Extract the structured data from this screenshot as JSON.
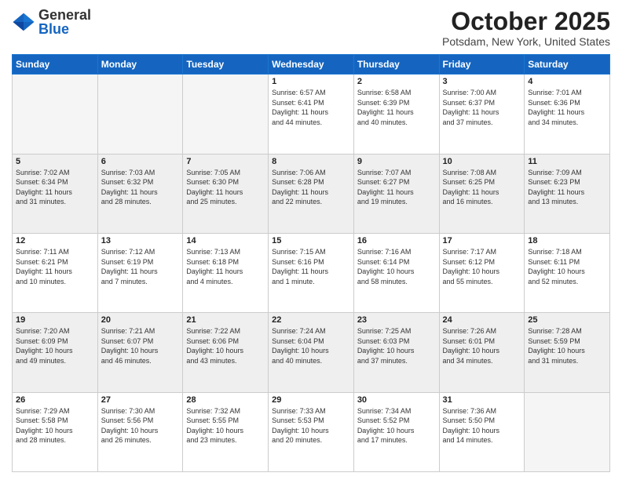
{
  "header": {
    "logo_general": "General",
    "logo_blue": "Blue",
    "month_title": "October 2025",
    "location": "Potsdam, New York, United States"
  },
  "days_of_week": [
    "Sunday",
    "Monday",
    "Tuesday",
    "Wednesday",
    "Thursday",
    "Friday",
    "Saturday"
  ],
  "weeks": [
    [
      {
        "day": "",
        "info": ""
      },
      {
        "day": "",
        "info": ""
      },
      {
        "day": "",
        "info": ""
      },
      {
        "day": "1",
        "info": "Sunrise: 6:57 AM\nSunset: 6:41 PM\nDaylight: 11 hours\nand 44 minutes."
      },
      {
        "day": "2",
        "info": "Sunrise: 6:58 AM\nSunset: 6:39 PM\nDaylight: 11 hours\nand 40 minutes."
      },
      {
        "day": "3",
        "info": "Sunrise: 7:00 AM\nSunset: 6:37 PM\nDaylight: 11 hours\nand 37 minutes."
      },
      {
        "day": "4",
        "info": "Sunrise: 7:01 AM\nSunset: 6:36 PM\nDaylight: 11 hours\nand 34 minutes."
      }
    ],
    [
      {
        "day": "5",
        "info": "Sunrise: 7:02 AM\nSunset: 6:34 PM\nDaylight: 11 hours\nand 31 minutes."
      },
      {
        "day": "6",
        "info": "Sunrise: 7:03 AM\nSunset: 6:32 PM\nDaylight: 11 hours\nand 28 minutes."
      },
      {
        "day": "7",
        "info": "Sunrise: 7:05 AM\nSunset: 6:30 PM\nDaylight: 11 hours\nand 25 minutes."
      },
      {
        "day": "8",
        "info": "Sunrise: 7:06 AM\nSunset: 6:28 PM\nDaylight: 11 hours\nand 22 minutes."
      },
      {
        "day": "9",
        "info": "Sunrise: 7:07 AM\nSunset: 6:27 PM\nDaylight: 11 hours\nand 19 minutes."
      },
      {
        "day": "10",
        "info": "Sunrise: 7:08 AM\nSunset: 6:25 PM\nDaylight: 11 hours\nand 16 minutes."
      },
      {
        "day": "11",
        "info": "Sunrise: 7:09 AM\nSunset: 6:23 PM\nDaylight: 11 hours\nand 13 minutes."
      }
    ],
    [
      {
        "day": "12",
        "info": "Sunrise: 7:11 AM\nSunset: 6:21 PM\nDaylight: 11 hours\nand 10 minutes."
      },
      {
        "day": "13",
        "info": "Sunrise: 7:12 AM\nSunset: 6:19 PM\nDaylight: 11 hours\nand 7 minutes."
      },
      {
        "day": "14",
        "info": "Sunrise: 7:13 AM\nSunset: 6:18 PM\nDaylight: 11 hours\nand 4 minutes."
      },
      {
        "day": "15",
        "info": "Sunrise: 7:15 AM\nSunset: 6:16 PM\nDaylight: 11 hours\nand 1 minute."
      },
      {
        "day": "16",
        "info": "Sunrise: 7:16 AM\nSunset: 6:14 PM\nDaylight: 10 hours\nand 58 minutes."
      },
      {
        "day": "17",
        "info": "Sunrise: 7:17 AM\nSunset: 6:12 PM\nDaylight: 10 hours\nand 55 minutes."
      },
      {
        "day": "18",
        "info": "Sunrise: 7:18 AM\nSunset: 6:11 PM\nDaylight: 10 hours\nand 52 minutes."
      }
    ],
    [
      {
        "day": "19",
        "info": "Sunrise: 7:20 AM\nSunset: 6:09 PM\nDaylight: 10 hours\nand 49 minutes."
      },
      {
        "day": "20",
        "info": "Sunrise: 7:21 AM\nSunset: 6:07 PM\nDaylight: 10 hours\nand 46 minutes."
      },
      {
        "day": "21",
        "info": "Sunrise: 7:22 AM\nSunset: 6:06 PM\nDaylight: 10 hours\nand 43 minutes."
      },
      {
        "day": "22",
        "info": "Sunrise: 7:24 AM\nSunset: 6:04 PM\nDaylight: 10 hours\nand 40 minutes."
      },
      {
        "day": "23",
        "info": "Sunrise: 7:25 AM\nSunset: 6:03 PM\nDaylight: 10 hours\nand 37 minutes."
      },
      {
        "day": "24",
        "info": "Sunrise: 7:26 AM\nSunset: 6:01 PM\nDaylight: 10 hours\nand 34 minutes."
      },
      {
        "day": "25",
        "info": "Sunrise: 7:28 AM\nSunset: 5:59 PM\nDaylight: 10 hours\nand 31 minutes."
      }
    ],
    [
      {
        "day": "26",
        "info": "Sunrise: 7:29 AM\nSunset: 5:58 PM\nDaylight: 10 hours\nand 28 minutes."
      },
      {
        "day": "27",
        "info": "Sunrise: 7:30 AM\nSunset: 5:56 PM\nDaylight: 10 hours\nand 26 minutes."
      },
      {
        "day": "28",
        "info": "Sunrise: 7:32 AM\nSunset: 5:55 PM\nDaylight: 10 hours\nand 23 minutes."
      },
      {
        "day": "29",
        "info": "Sunrise: 7:33 AM\nSunset: 5:53 PM\nDaylight: 10 hours\nand 20 minutes."
      },
      {
        "day": "30",
        "info": "Sunrise: 7:34 AM\nSunset: 5:52 PM\nDaylight: 10 hours\nand 17 minutes."
      },
      {
        "day": "31",
        "info": "Sunrise: 7:36 AM\nSunset: 5:50 PM\nDaylight: 10 hours\nand 14 minutes."
      },
      {
        "day": "",
        "info": ""
      }
    ]
  ]
}
